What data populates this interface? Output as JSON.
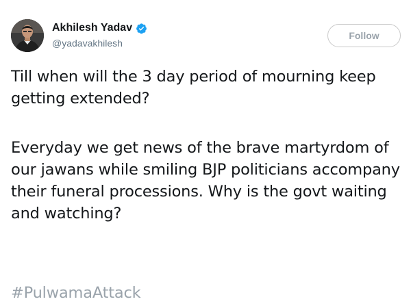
{
  "author": {
    "display_name": "Akhilesh Yadav",
    "handle": "@yadavakhilesh",
    "verified": true,
    "avatar_icon": "profile-photo"
  },
  "actions": {
    "follow_label": "Follow"
  },
  "tweet": {
    "paragraph_1": "Till when will the 3 day period of mourning keep getting extended?",
    "paragraph_2": "Everyday we get news of the brave martyrdom of our jawans while smiling BJP politicians accompany their funeral processions. Why is the govt waiting and watching?",
    "hashtag": "#PulwamaAttack"
  },
  "colors": {
    "text_primary": "#14171a",
    "text_secondary": "#657786",
    "verified_blue": "#1da1f2",
    "muted": "#9aa3ab",
    "button_border": "#c9c9c9"
  }
}
